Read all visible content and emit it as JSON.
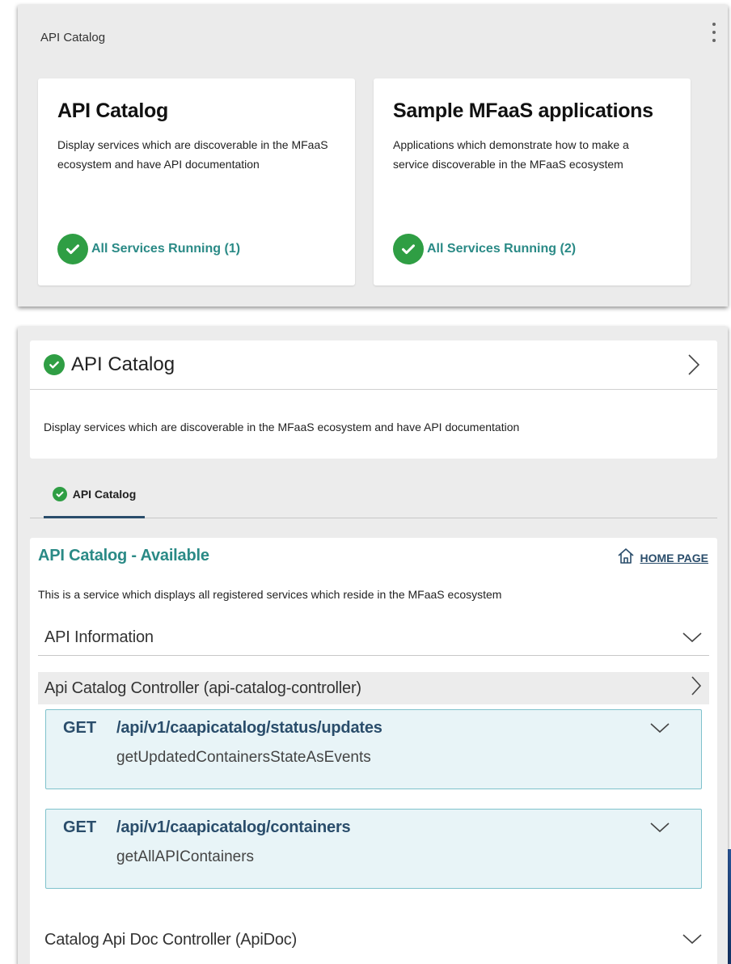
{
  "dashboard": {
    "title": "API Catalog",
    "tiles": [
      {
        "title": "API Catalog",
        "description": "Display services which are discoverable in the MFaaS ecosystem and have API documentation",
        "status": "All Services Running (1)"
      },
      {
        "title": "Sample MFaaS applications",
        "description": "Applications which demonstrate how to make a service discoverable in the MFaaS ecosystem",
        "status": "All Services Running (2)"
      }
    ]
  },
  "service": {
    "title": "API Catalog",
    "description": "Display services which are discoverable in the MFaaS ecosystem and have API documentation",
    "tab_label": "API Catalog"
  },
  "api": {
    "title": "API Catalog - Available",
    "home_label": "HOME PAGE",
    "description": "This is a service which displays all registered services which reside in the MFaaS ecosystem",
    "sections": {
      "info": "API Information",
      "controller": "Api Catalog Controller (api-catalog-controller)",
      "doc_controller": "Catalog Api Doc Controller (ApiDoc)"
    },
    "endpoints": [
      {
        "method": "GET",
        "path": "/api/v1/caapicatalog/status/updates",
        "operation": "getUpdatedContainersStateAsEvents"
      },
      {
        "method": "GET",
        "path": "/api/v1/caapicatalog/containers",
        "operation": "getAllAPIContainers"
      }
    ]
  },
  "colors": {
    "accent_teal": "#2a8a86",
    "status_green": "#2f9e44",
    "navy": "#2a4d6b",
    "endpoint_bg": "#e8f4f7"
  },
  "icons": [
    "kebab-menu-icon",
    "check-circle-icon",
    "chevron-right-icon",
    "chevron-down-icon",
    "home-icon"
  ]
}
